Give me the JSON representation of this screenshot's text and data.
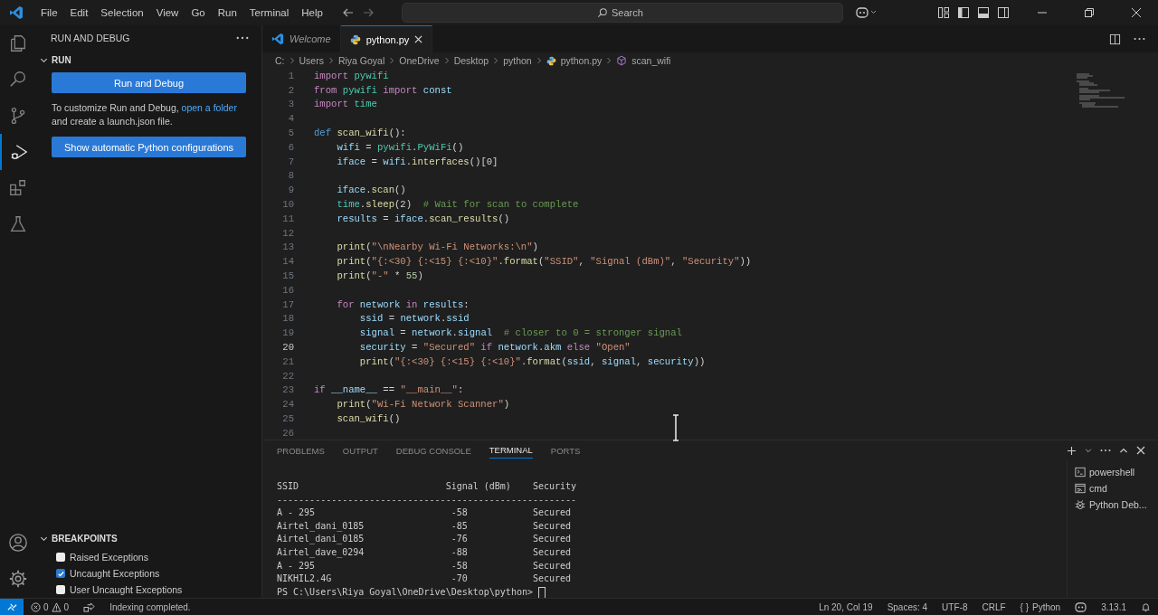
{
  "title_bar": {
    "menus": [
      "File",
      "Edit",
      "Selection",
      "View",
      "Go",
      "Run",
      "Terminal",
      "Help"
    ],
    "search": {
      "placeholder": "Search"
    }
  },
  "activity_bar": {
    "items": [
      {
        "kind": "explorer",
        "selected": false
      },
      {
        "kind": "search",
        "selected": false
      },
      {
        "kind": "source-control",
        "selected": false
      },
      {
        "kind": "run",
        "selected": true
      },
      {
        "kind": "extensions",
        "selected": false
      },
      {
        "kind": "testing",
        "selected": false
      }
    ]
  },
  "sidebar": {
    "title": "RUN AND DEBUG",
    "run_section": {
      "title": "RUN",
      "expanded": true,
      "button": "Run and Debug",
      "text_before": "To customize Run and Debug, ",
      "link": "open a folder",
      "text_after": " and create a launch.json file.",
      "button_2": "Show automatic Python configurations"
    },
    "breakpoints": {
      "title": "BREAKPOINTS",
      "expanded": true,
      "items": [
        {
          "label": "Raised Exceptions",
          "checked": false
        },
        {
          "label": "Uncaught Exceptions",
          "checked": true
        },
        {
          "label": "User Uncaught Exceptions",
          "checked": false
        }
      ]
    }
  },
  "tabs": [
    {
      "label": "Welcome",
      "kind": "welcome",
      "selected": false
    },
    {
      "label": "python.py",
      "kind": "python",
      "selected": true
    }
  ],
  "breadcrumb": [
    {
      "label": "C:",
      "kind": "folder"
    },
    {
      "label": "Users",
      "kind": "folder"
    },
    {
      "label": "Riya Goyal",
      "kind": "folder"
    },
    {
      "label": "OneDrive",
      "kind": "folder"
    },
    {
      "label": "Desktop",
      "kind": "folder"
    },
    {
      "label": "python",
      "kind": "folder"
    },
    {
      "label": "python.py",
      "kind": "file"
    },
    {
      "label": "scan_wifi",
      "kind": "symbol"
    }
  ],
  "code": [
    {
      "n": "1",
      "current": false,
      "tokens": [
        {
          "t": "import",
          "kind": "keyword"
        },
        {
          "t": " pywifi",
          "kind": "module"
        }
      ]
    },
    {
      "n": "2",
      "current": false,
      "tokens": [
        {
          "t": "from",
          "kind": "keyword"
        },
        {
          "t": " pywifi ",
          "kind": "module"
        },
        {
          "t": "import",
          "kind": "keyword"
        },
        {
          "t": " const",
          "kind": "variable"
        }
      ]
    },
    {
      "n": "3",
      "current": false,
      "tokens": [
        {
          "t": "import",
          "kind": "keyword"
        },
        {
          "t": " time",
          "kind": "module"
        }
      ]
    },
    {
      "n": "4",
      "current": false
    },
    {
      "n": "5",
      "current": false,
      "tokens": [
        {
          "t": "def",
          "kind": "storage"
        },
        {
          "t": " scan_wifi",
          "kind": "function"
        },
        {
          "t": "():",
          "kind": "plain"
        }
      ]
    },
    {
      "n": "6",
      "current": false,
      "tokens": [
        {
          "t": "    wifi",
          "kind": "variable"
        },
        {
          "t": " = ",
          "kind": "plain"
        },
        {
          "t": "pywifi",
          "kind": "module"
        },
        {
          "t": ".",
          "kind": "plain"
        },
        {
          "t": "PyWiFi",
          "kind": "module"
        },
        {
          "t": "()",
          "kind": "plain"
        }
      ]
    },
    {
      "n": "7",
      "current": false,
      "tokens": [
        {
          "t": "    iface",
          "kind": "variable"
        },
        {
          "t": " = ",
          "kind": "plain"
        },
        {
          "t": "wifi",
          "kind": "variable"
        },
        {
          "t": ".",
          "kind": "plain"
        },
        {
          "t": "interfaces",
          "kind": "function"
        },
        {
          "t": "()[0]",
          "kind": "plain"
        }
      ]
    },
    {
      "n": "8",
      "current": false
    },
    {
      "n": "9",
      "current": false,
      "tokens": [
        {
          "t": "    iface",
          "kind": "variable"
        },
        {
          "t": ".",
          "kind": "plain"
        },
        {
          "t": "scan",
          "kind": "function"
        },
        {
          "t": "()",
          "kind": "plain"
        }
      ]
    },
    {
      "n": "10",
      "current": false,
      "tokens": [
        {
          "t": "    time",
          "kind": "module"
        },
        {
          "t": ".",
          "kind": "plain"
        },
        {
          "t": "sleep",
          "kind": "function"
        },
        {
          "t": "(2)",
          "kind": "plain"
        },
        {
          "t": "  # Wait for scan to complete",
          "kind": "comment"
        }
      ]
    },
    {
      "n": "11",
      "current": false,
      "tokens": [
        {
          "t": "    results",
          "kind": "variable"
        },
        {
          "t": " = ",
          "kind": "plain"
        },
        {
          "t": "iface",
          "kind": "variable"
        },
        {
          "t": ".",
          "kind": "plain"
        },
        {
          "t": "scan_results",
          "kind": "function"
        },
        {
          "t": "()",
          "kind": "plain"
        }
      ]
    },
    {
      "n": "12",
      "current": false
    },
    {
      "n": "13",
      "current": false,
      "tokens": [
        {
          "t": "    print",
          "kind": "function"
        },
        {
          "t": "(",
          "kind": "plain"
        },
        {
          "t": "\"\\nNearby Wi-Fi Networks:\\n\"",
          "kind": "string"
        },
        {
          "t": ")",
          "kind": "plain"
        }
      ]
    },
    {
      "n": "14",
      "current": false,
      "tokens": [
        {
          "t": "    print",
          "kind": "function"
        },
        {
          "t": "(",
          "kind": "plain"
        },
        {
          "t": "\"{:<30} {:<15} {:<10}\"",
          "kind": "string"
        },
        {
          "t": ".",
          "kind": "plain"
        },
        {
          "t": "format",
          "kind": "function"
        },
        {
          "t": "(",
          "kind": "plain"
        },
        {
          "t": "\"SSID\"",
          "kind": "string"
        },
        {
          "t": ", ",
          "kind": "plain"
        },
        {
          "t": "\"Signal (dBm)\"",
          "kind": "string"
        },
        {
          "t": ", ",
          "kind": "plain"
        },
        {
          "t": "\"Security\"",
          "kind": "string"
        },
        {
          "t": "))",
          "kind": "plain"
        }
      ]
    },
    {
      "n": "15",
      "current": false,
      "tokens": [
        {
          "t": "    print",
          "kind": "function"
        },
        {
          "t": "(",
          "kind": "plain"
        },
        {
          "t": "\"-\"",
          "kind": "string"
        },
        {
          "t": " * ",
          "kind": "plain"
        },
        {
          "t": "55",
          "kind": "number"
        },
        {
          "t": ")",
          "kind": "plain"
        }
      ]
    },
    {
      "n": "16",
      "current": false
    },
    {
      "n": "17",
      "current": false,
      "tokens": [
        {
          "t": "    for",
          "kind": "keyword"
        },
        {
          "t": " network ",
          "kind": "variable"
        },
        {
          "t": "in",
          "kind": "keyword"
        },
        {
          "t": " results",
          "kind": "variable"
        },
        {
          "t": ":",
          "kind": "plain"
        }
      ]
    },
    {
      "n": "18",
      "current": false,
      "tokens": [
        {
          "t": "        ssid",
          "kind": "variable"
        },
        {
          "t": " = ",
          "kind": "plain"
        },
        {
          "t": "network",
          "kind": "variable"
        },
        {
          "t": ".",
          "kind": "plain"
        },
        {
          "t": "ssid",
          "kind": "variable"
        }
      ]
    },
    {
      "n": "19",
      "current": false,
      "tokens": [
        {
          "t": "        signal",
          "kind": "variable"
        },
        {
          "t": " = ",
          "kind": "plain"
        },
        {
          "t": "network",
          "kind": "variable"
        },
        {
          "t": ".",
          "kind": "plain"
        },
        {
          "t": "signal",
          "kind": "variable"
        },
        {
          "t": "  # closer to 0 = stronger signal",
          "kind": "comment"
        }
      ]
    },
    {
      "n": "20",
      "current": true,
      "tokens": [
        {
          "t": "        security",
          "kind": "variable"
        },
        {
          "t": " = ",
          "kind": "plain"
        },
        {
          "t": "\"Secured\"",
          "kind": "string"
        },
        {
          "t": " if ",
          "kind": "keyword"
        },
        {
          "t": "network",
          "kind": "variable"
        },
        {
          "t": ".",
          "kind": "plain"
        },
        {
          "t": "akm",
          "kind": "variable"
        },
        {
          "t": " else ",
          "kind": "keyword"
        },
        {
          "t": "\"Open\"",
          "kind": "string"
        }
      ]
    },
    {
      "n": "21",
      "current": false,
      "tokens": [
        {
          "t": "        print",
          "kind": "function"
        },
        {
          "t": "(",
          "kind": "plain"
        },
        {
          "t": "\"{:<30} {:<15} {:<10}\"",
          "kind": "string"
        },
        {
          "t": ".",
          "kind": "plain"
        },
        {
          "t": "format",
          "kind": "function"
        },
        {
          "t": "(",
          "kind": "plain"
        },
        {
          "t": "ssid",
          "kind": "variable"
        },
        {
          "t": ", ",
          "kind": "plain"
        },
        {
          "t": "signal",
          "kind": "variable"
        },
        {
          "t": ", ",
          "kind": "plain"
        },
        {
          "t": "security",
          "kind": "variable"
        },
        {
          "t": "))",
          "kind": "plain"
        }
      ]
    },
    {
      "n": "22",
      "current": false
    },
    {
      "n": "23",
      "current": false,
      "tokens": [
        {
          "t": "if",
          "kind": "keyword"
        },
        {
          "t": " __name__",
          "kind": "variable"
        },
        {
          "t": " == ",
          "kind": "plain"
        },
        {
          "t": "\"__main__\"",
          "kind": "string"
        },
        {
          "t": ":",
          "kind": "plain"
        }
      ]
    },
    {
      "n": "24",
      "current": false,
      "tokens": [
        {
          "t": "    print",
          "kind": "function"
        },
        {
          "t": "(",
          "kind": "plain"
        },
        {
          "t": "\"Wi-Fi Network Scanner\"",
          "kind": "string"
        },
        {
          "t": ")",
          "kind": "plain"
        }
      ]
    },
    {
      "n": "25",
      "current": false,
      "tokens": [
        {
          "t": "    scan_wifi",
          "kind": "function"
        },
        {
          "t": "()",
          "kind": "plain"
        }
      ]
    },
    {
      "n": "26",
      "current": false
    }
  ],
  "panel": {
    "tabs": [
      {
        "label": "PROBLEMS",
        "selected": false
      },
      {
        "label": "OUTPUT",
        "selected": false
      },
      {
        "label": "DEBUG CONSOLE",
        "selected": false
      },
      {
        "label": "TERMINAL",
        "selected": true
      },
      {
        "label": "PORTS",
        "selected": false
      }
    ],
    "terminal_lines": [
      "SSID                           Signal (dBm)    Security",
      "-------------------------------------------------------",
      "A - 295                         -58            Secured",
      "Airtel_dani_0185                -85            Secured",
      "Airtel_dani_0185                -76            Secured",
      "Airtel_dave_0294                -88            Secured",
      "A - 295                         -58            Secured",
      "NIKHIL2.4G                      -70            Secured"
    ],
    "prompt": "PS C:\\Users\\Riya Goyal\\OneDrive\\Desktop\\python>",
    "terminals": [
      {
        "label": "powershell",
        "kind": "shell",
        "selected": false
      },
      {
        "label": "cmd",
        "kind": "cmd",
        "selected": false
      },
      {
        "label": "Python Deb...",
        "kind": "debug",
        "selected": false
      }
    ]
  },
  "status_bar": {
    "errors": "0",
    "warnings": "0",
    "message": "Indexing completed.",
    "right": [
      "Ln 20, Col 19",
      "Spaces: 4",
      "UTF-8",
      "CRLF"
    ],
    "language_icon": "{ }",
    "language": "Python",
    "version": "3.13.1"
  }
}
